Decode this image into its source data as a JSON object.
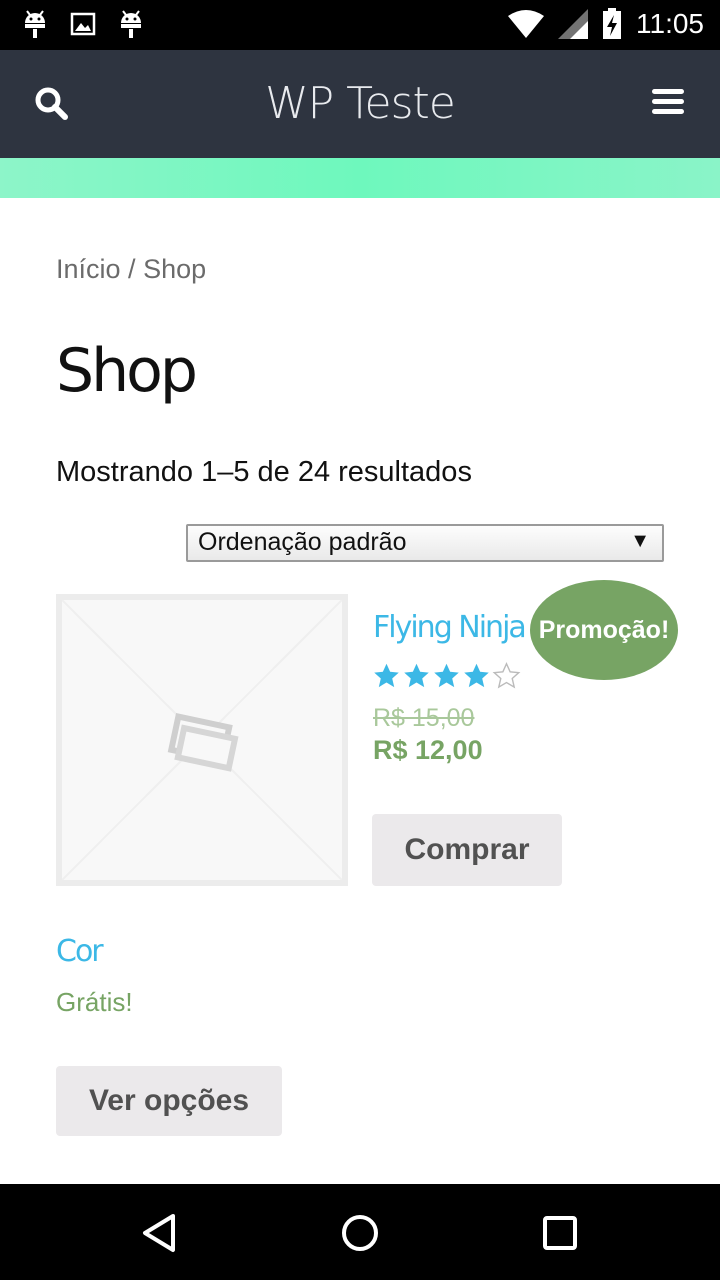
{
  "status_bar": {
    "time": "11:05",
    "icons": [
      "android-icon",
      "image-icon",
      "android-icon",
      "wifi-icon",
      "signal-icon",
      "battery-charging-icon"
    ]
  },
  "header": {
    "site_title": "WP Teste",
    "search_icon": "search-icon",
    "menu_icon": "hamburger-menu-icon",
    "background_color": "#2e3440",
    "accent_color": "#6ef8bd"
  },
  "breadcrumb": {
    "home": "Início",
    "separator": " / ",
    "current": "Shop"
  },
  "page": {
    "title": "Shop",
    "result_count": "Mostrando 1–5 de 24 resultados",
    "sort_selected": "Ordenação padrão"
  },
  "products": [
    {
      "name": "Flying Ninja",
      "sale_badge": "Promoção!",
      "rating": 4,
      "rating_max": 5,
      "regular_price": "R$ 15,00",
      "sale_price": "R$ 12,00",
      "button_label": "Comprar"
    },
    {
      "name": "Cor",
      "price": "Grátis!",
      "button_label": "Ver opções"
    }
  ],
  "colors": {
    "link": "#3cb8e6",
    "price": "#77a464",
    "star": "#3cb8e6"
  }
}
